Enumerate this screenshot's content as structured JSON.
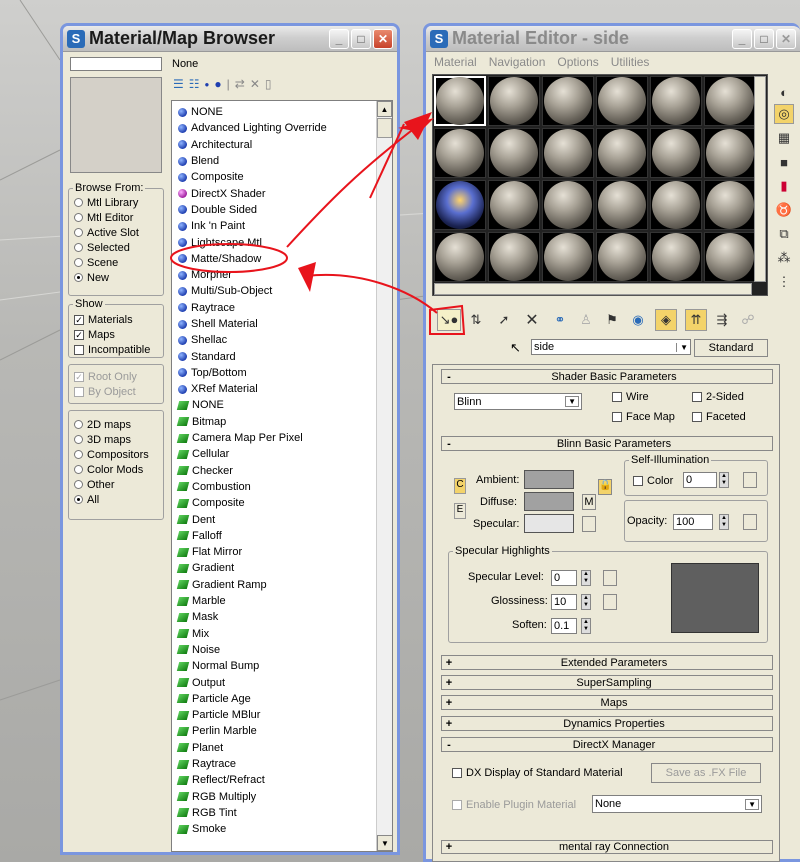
{
  "browser": {
    "title": "Material/Map Browser",
    "selected_name": "None",
    "browse_from_label": "Browse From:",
    "browse_from": [
      {
        "label": "Mtl Library",
        "selected": false
      },
      {
        "label": "Mtl Editor",
        "selected": false
      },
      {
        "label": "Active Slot",
        "selected": false
      },
      {
        "label": "Selected",
        "selected": false
      },
      {
        "label": "Scene",
        "selected": false
      },
      {
        "label": "New",
        "selected": true
      }
    ],
    "show_label": "Show",
    "show": [
      {
        "label": "Materials",
        "checked": true
      },
      {
        "label": "Maps",
        "checked": true
      },
      {
        "label": "Incompatible",
        "checked": false
      }
    ],
    "root_only": "Root Only",
    "by_object": "By Object",
    "map_types": [
      {
        "label": "2D maps",
        "selected": false
      },
      {
        "label": "3D maps",
        "selected": false
      },
      {
        "label": "Compositors",
        "selected": false
      },
      {
        "label": "Color Mods",
        "selected": false
      },
      {
        "label": "Other",
        "selected": false
      },
      {
        "label": "All",
        "selected": true
      }
    ],
    "materials": [
      "NONE",
      "Advanced Lighting Override",
      "Architectural",
      "Blend",
      "Composite",
      "DirectX Shader",
      "Double Sided",
      "Ink 'n Paint",
      "Lightscape Mtl",
      "Matte/Shadow",
      "Morpher",
      "Multi/Sub-Object",
      "Raytrace",
      "Shell Material",
      "Shellac",
      "Standard",
      "Top/Bottom",
      "XRef Material"
    ],
    "maps": [
      "NONE",
      "Bitmap",
      "Camera Map Per Pixel",
      "Cellular",
      "Checker",
      "Combustion",
      "Composite",
      "Dent",
      "Falloff",
      "Flat Mirror",
      "Gradient",
      "Gradient Ramp",
      "Marble",
      "Mask",
      "Mix",
      "Noise",
      "Normal Bump",
      "Output",
      "Particle Age",
      "Particle MBlur",
      "Perlin Marble",
      "Planet",
      "Raytrace",
      "Reflect/Refract",
      "RGB Multiply",
      "RGB Tint",
      "Smoke"
    ]
  },
  "editor": {
    "title": "Material Editor - side",
    "menu": [
      "Material",
      "Navigation",
      "Options",
      "Utilities"
    ],
    "material_name": "side",
    "type_button": "Standard",
    "shader_rollout": "Shader Basic Parameters",
    "shader": "Blinn",
    "wire": "Wire",
    "two_sided": "2-Sided",
    "face_map": "Face Map",
    "faceted": "Faceted",
    "blinn_rollout": "Blinn Basic Parameters",
    "self_illum_label": "Self-Illumination",
    "color_label": "Color",
    "color_value": "0",
    "ambient": "Ambient:",
    "diffuse": "Diffuse:",
    "specular": "Specular:",
    "m_button": "M",
    "opacity_label": "Opacity:",
    "opacity_value": "100",
    "spec_highlights": "Specular Highlights",
    "spec_level_label": "Specular Level:",
    "spec_level": "0",
    "glossiness_label": "Glossiness:",
    "glossiness": "10",
    "soften_label": "Soften:",
    "soften": "0.1",
    "rollouts": [
      {
        "sign": "+",
        "label": "Extended Parameters"
      },
      {
        "sign": "+",
        "label": "SuperSampling"
      },
      {
        "sign": "+",
        "label": "Maps"
      },
      {
        "sign": "+",
        "label": "Dynamics Properties"
      },
      {
        "sign": "-",
        "label": "DirectX Manager"
      }
    ],
    "dx_display": "DX Display of Standard Material",
    "save_fx": "Save as .FX File",
    "enable_plugin": "Enable Plugin Material",
    "plugin_value": "None",
    "mental_ray": "mental ray Connection"
  },
  "colors": {
    "annotation": "#e8141c",
    "title_blue": "#2a6bb8"
  }
}
